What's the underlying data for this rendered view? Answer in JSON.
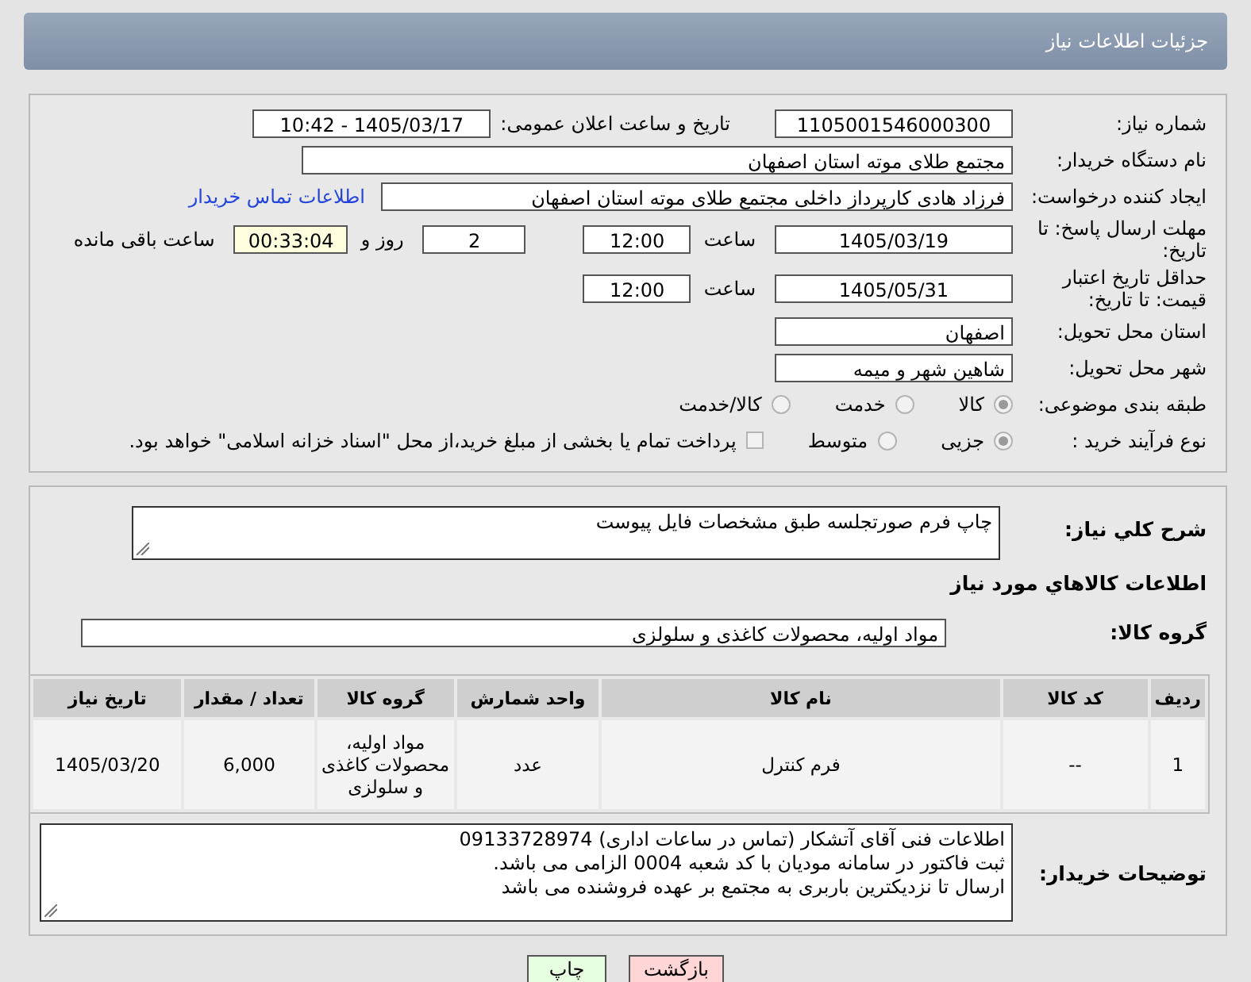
{
  "header": {
    "title": "جزئیات اطلاعات نیاز"
  },
  "need_info": {
    "need_number": {
      "label": "شماره نیاز:",
      "value": "1105001546000300"
    },
    "announce": {
      "label": "تاریخ و ساعت اعلان عمومی:",
      "value": "1405/03/17 - 10:42"
    },
    "buyer_org": {
      "label": "نام دستگاه خریدار:",
      "value": "مجتمع طلای موته استان اصفهان"
    },
    "requester": {
      "label": "ایجاد کننده درخواست:",
      "value": "فرزاد هادی کارپرداز داخلی مجتمع طلای موته استان اصفهان",
      "link": "اطلاعات تماس خریدار"
    },
    "deadline": {
      "label": "مهلت ارسال پاسخ: تا تاریخ:",
      "date": "1405/03/19",
      "time_label": "ساعت",
      "time": "12:00",
      "days": "2",
      "days_label": "روز و",
      "remaining": "00:33:04",
      "remaining_label": "ساعت باقی مانده"
    },
    "validity": {
      "label": "حداقل تاریخ اعتبار قیمت: تا تاریخ:",
      "date": "1405/05/31",
      "time_label": "ساعت",
      "time": "12:00"
    },
    "province": {
      "label": "استان محل تحویل:",
      "value": "اصفهان"
    },
    "city": {
      "label": "شهر محل تحویل:",
      "value": "شاهین شهر و میمه"
    },
    "category": {
      "label": "طبقه بندی موضوعی:",
      "options": [
        {
          "label": "کالا",
          "selected": true
        },
        {
          "label": "خدمت",
          "selected": false
        },
        {
          "label": "کالا/خدمت",
          "selected": false
        }
      ]
    },
    "purchase_type": {
      "label": "نوع فرآیند خرید :",
      "options": [
        {
          "label": "جزیی",
          "selected": true
        },
        {
          "label": "متوسط",
          "selected": false
        }
      ],
      "treasury": {
        "label": "پرداخت تمام یا بخشی از مبلغ خرید،از محل \"اسناد خزانه اسلامی\" خواهد بود.",
        "checked": false
      }
    }
  },
  "description": {
    "label": "شرح کلي نياز:",
    "value": "چاپ فرم صورتجلسه طبق مشخصات فایل پیوست"
  },
  "goods": {
    "title": "اطلاعات کالاهاي مورد نياز",
    "group": {
      "label": "گروه کالا:",
      "value": "مواد اولیه، محصولات کاغذی و سلولزی"
    },
    "table": {
      "columns": [
        "ردیف",
        "کد کالا",
        "نام کالا",
        "واحد شمارش",
        "گروه کالا",
        "تعداد / مقدار",
        "تاریخ نیاز"
      ],
      "rows": [
        [
          "1",
          "--",
          "فرم کنترل",
          "عدد",
          "مواد اولیه، محصولات کاغذی و سلولزی",
          "6,000",
          "1405/03/20"
        ]
      ]
    }
  },
  "buyer_notes": {
    "label": "توضیحات خریدار:",
    "lines": [
      "اطلاعات فنی آقای آتشکار (تماس در ساعات اداری) 09133728974",
      "ثبت فاکتور در سامانه مودیان با کد شعبه 0004 الزامی می باشد.",
      "ارسال تا نزدیکترین باربری به مجتمع بر عهده فروشنده می باشد"
    ]
  },
  "buttons": [
    {
      "label": "بازگشت",
      "kind": "back"
    },
    {
      "label": "چاپ",
      "kind": "print"
    }
  ]
}
